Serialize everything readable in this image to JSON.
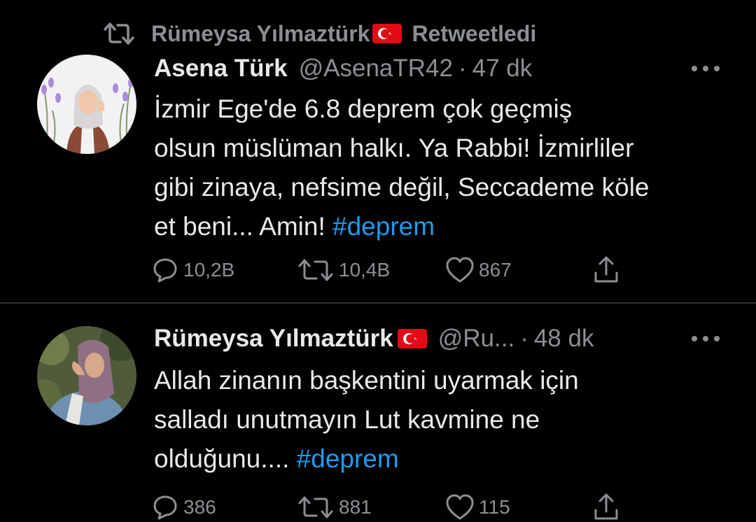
{
  "retweet_banner": {
    "user": "Rümeysa Yılmaztürk",
    "label": "Retweetledi"
  },
  "tweets": [
    {
      "display_name": "Asena Türk",
      "handle": "@AsenaTR42",
      "separator": "·",
      "time": "47 dk",
      "text": "İzmir Ege'de 6.8  deprem çok geçmiş\nolsun müslüman halkı. Ya Rabbi! İzmirliler\ngibi zinaya, nefsime değil, Seccademe köle\net beni... Amin! ",
      "hashtag": "#deprem",
      "replies": "10,2B",
      "retweets": "10,4B",
      "likes": "867"
    },
    {
      "display_name": "Rümeysa Yılmaztürk",
      "handle": "@Ru...",
      "separator": "·",
      "time": "48 dk",
      "text": "Allah zinanın başkentini uyarmak için\nsalladı unutmayın Lut kavmine ne\nolduğunu.... ",
      "hashtag": "#deprem",
      "replies": "386",
      "retweets": "881",
      "likes": "115"
    }
  ],
  "colors": {
    "background": "#000000",
    "text": "#e7e9ea",
    "secondary": "#8b8f94",
    "hashtag": "#1d9bf0",
    "divider": "#2f3336",
    "flag_red": "#e30a17"
  },
  "icons": [
    "retweet-icon",
    "turkish-flag-icon",
    "more-icon",
    "reply-icon",
    "like-icon",
    "share-icon"
  ]
}
